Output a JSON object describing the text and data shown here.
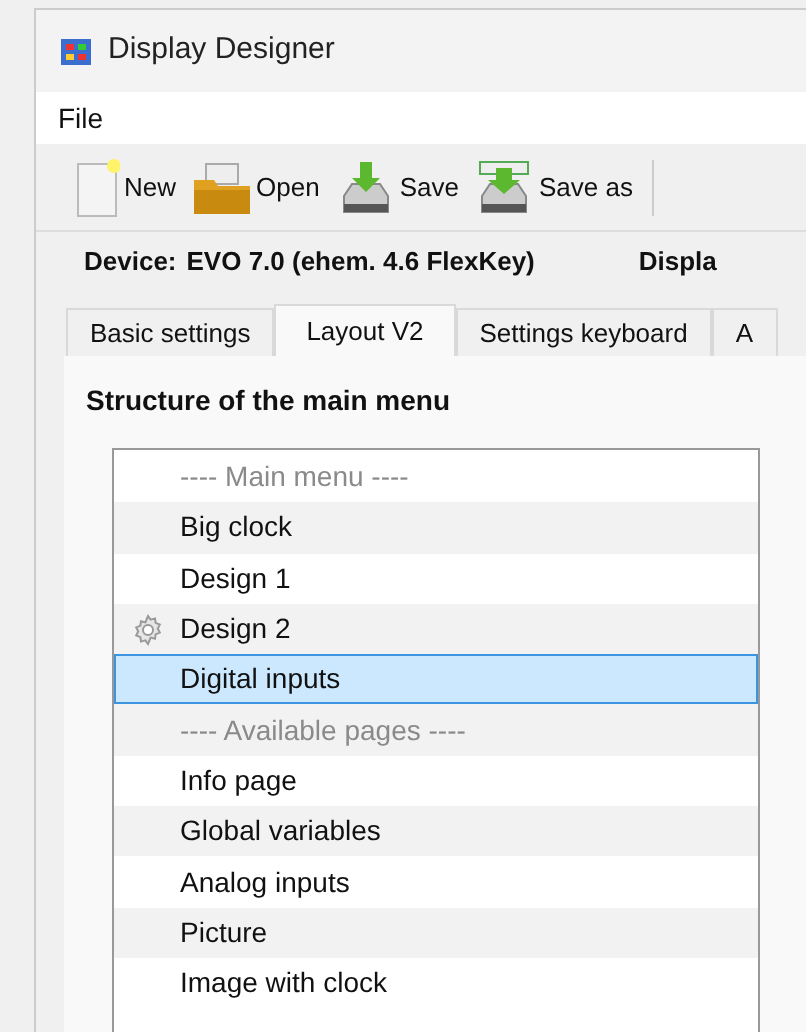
{
  "window": {
    "title": "Display Designer"
  },
  "menu": [
    "File"
  ],
  "toolbar": [
    {
      "kind": "new",
      "label": "New"
    },
    {
      "kind": "open",
      "label": "Open"
    },
    {
      "kind": "save",
      "label": "Save"
    },
    {
      "kind": "saveas",
      "label": "Save as"
    }
  ],
  "device": {
    "label": "Device:",
    "value": "EVO 7.0 (ehem. 4.6 FlexKey)",
    "next_label": "Displa"
  },
  "tabs": [
    {
      "label": "Basic settings",
      "selected": false
    },
    {
      "label": "Layout V2",
      "selected": true
    },
    {
      "label": "Settings keyboard",
      "selected": false
    },
    {
      "label": "A",
      "selected": false
    }
  ],
  "section_title": "Structure of the main menu",
  "menu_structure": [
    {
      "kind": "separator",
      "label": "---- Main menu ----",
      "selected": false
    },
    {
      "kind": "page",
      "label": "Big clock",
      "selected": false
    },
    {
      "kind": "page",
      "label": "Design 1",
      "selected": false
    },
    {
      "kind": "gear",
      "label": "Design 2",
      "selected": false
    },
    {
      "kind": "page",
      "label": "Digital inputs",
      "selected": true
    },
    {
      "kind": "separator",
      "label": "---- Available pages ----",
      "selected": false
    },
    {
      "kind": "page",
      "label": "Info page",
      "selected": false
    },
    {
      "kind": "page",
      "label": "Global variables",
      "selected": false
    },
    {
      "kind": "page",
      "label": "Analog inputs",
      "selected": false
    },
    {
      "kind": "page",
      "label": "Picture",
      "selected": false
    },
    {
      "kind": "page",
      "label": "Image with clock",
      "selected": false
    }
  ]
}
